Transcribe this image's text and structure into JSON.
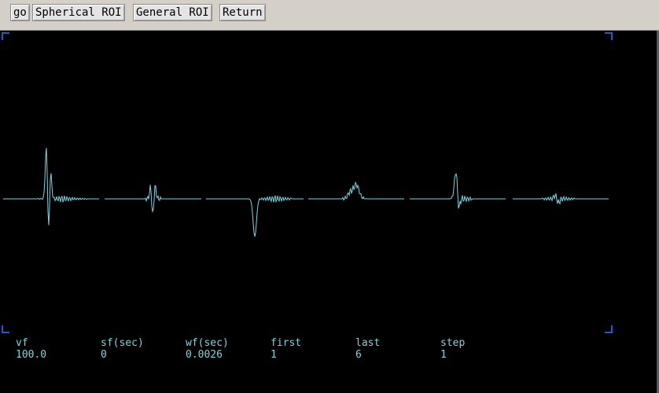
{
  "toolbar": {
    "go_label": "go",
    "spherical_roi_label": "Spherical ROI",
    "general_roi_label": "General ROI",
    "return_label": "Return"
  },
  "parameters": [
    {
      "label": "vf",
      "value": "100.0"
    },
    {
      "label": "sf(sec)",
      "value": "0"
    },
    {
      "label": "wf(sec)",
      "value": "0.0026"
    },
    {
      "label": "first",
      "value": "1"
    },
    {
      "label": "last",
      "value": "6"
    },
    {
      "label": "step",
      "value": "1"
    }
  ],
  "waveform": {
    "color": "#7fd4e4",
    "segment_count": 6
  },
  "colors": {
    "background": "#000000",
    "trace": "#7fd4e4",
    "frame_corners": "#1e5cc8"
  }
}
